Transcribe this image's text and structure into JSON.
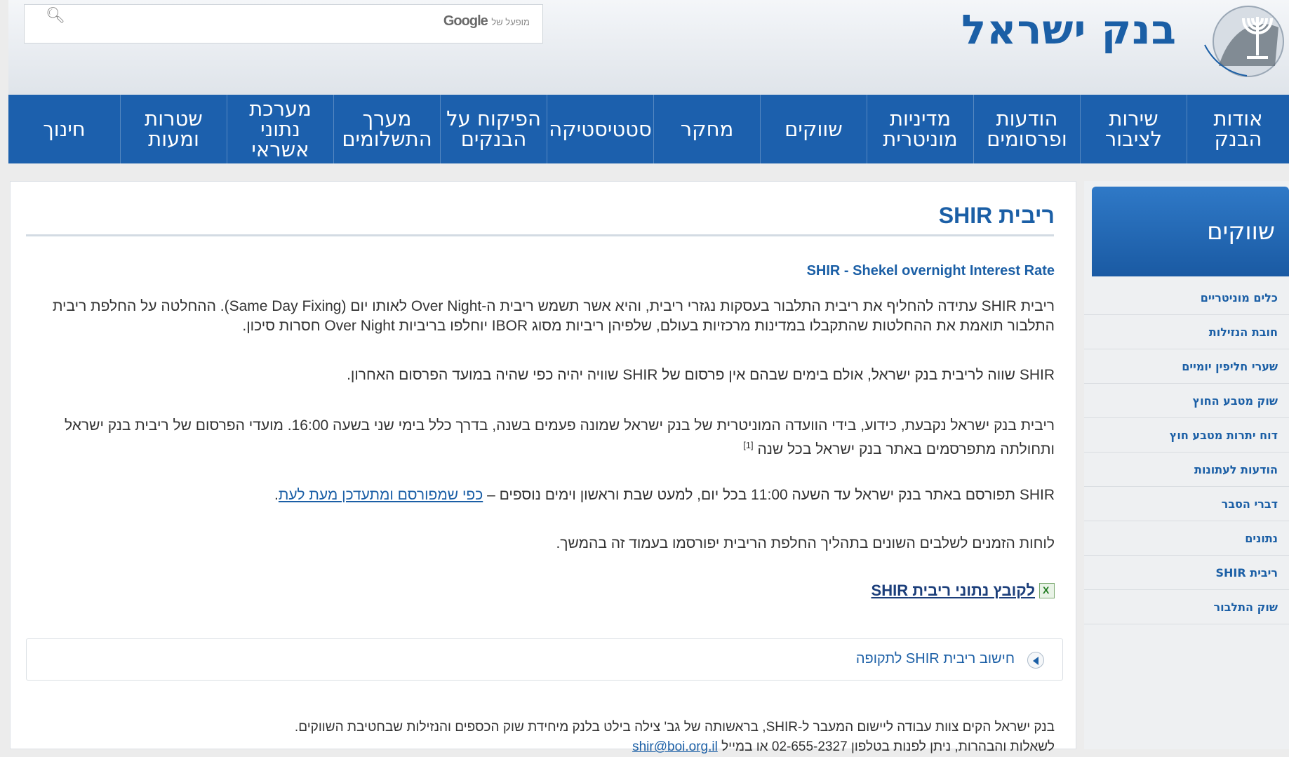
{
  "header": {
    "bank_name": "בנק ישראל",
    "search": {
      "brand": "Google",
      "brand_suffix": "מופעל של",
      "search_icon": "search-icon"
    }
  },
  "nav": {
    "items": [
      {
        "label": "אודות\nהבנק"
      },
      {
        "label": "שירות\nלציבור"
      },
      {
        "label": "הודעות\nופרסומים"
      },
      {
        "label": "מדיניות\nמוניטרית"
      },
      {
        "label": "שווקים"
      },
      {
        "label": "מחקר"
      },
      {
        "label": "סטטיסטיקה"
      },
      {
        "label": "הפיקוח על\nהבנקים"
      },
      {
        "label": "מערך\nהתשלומים"
      },
      {
        "label": "מערכת\nנתוני\nאשראי"
      },
      {
        "label": "שטרות\nומעות"
      },
      {
        "label": "חינוך"
      }
    ]
  },
  "sidebar": {
    "heading": "שווקים",
    "items": [
      {
        "label": "כלים מוניטריים"
      },
      {
        "label": "חובת הנזילות"
      },
      {
        "label": "שערי חליפין יומיים"
      },
      {
        "label": "שוק מטבע החוץ"
      },
      {
        "label": "דוח יתרות מטבע חוץ"
      },
      {
        "label": "הודעות לעתונות"
      },
      {
        "label": "דברי הסבר"
      },
      {
        "label": "נתונים"
      },
      {
        "label": "ריבית SHIR"
      },
      {
        "label": "שוק התלבור"
      }
    ]
  },
  "main": {
    "title": "ריבית SHIR",
    "subtitle": "SHIR - Shekel overnight Interest Rate",
    "p1": "ריבית  SHIR עתידה להחליף את ריבית התלבור בעסקות נגזרי ריבית, והיא אשר תשמש ריבית ה-Over Night לאותו יום  (Same Day Fixing). ההחלטה על החלפת ריבית התלבור תואמת את ההחלטות שהתקבלו במדינות מרכזיות בעולם, שלפיהן ריביות מסוג  IBOR יוחלפו בריביות  Over Night חסרות סיכון.",
    "p2": "SHIR שווה לריבית בנק ישראל, אולם בימים שבהם אין פרסום של SHIR שוויה יהיה כפי שהיה במועד הפרסום האחרון.",
    "p3": "ריבית בנק ישראל נקבעת, כידוע, בידי הוועדה המוניטרית של בנק ישראל שמונה פעמים בשנה, בדרך כלל בימי שני בשעה 16:00. מועדי הפרסום של ריבית בנק ישראל ותחולתה מתפרסמים באתר בנק ישראל בכל שנה ",
    "p3_footnote": "[1]",
    "p4_text": "SHIR תפורסם באתר בנק ישראל עד השעה 11:00 בכל יום, למעט שבת וראשון וימים נוספים – ",
    "p4_link": "כפי שמפורסם ומתעדכן מעת לעת",
    "p4_end": ".",
    "p5": "לוחות הזמנים לשלבים השונים בתהליך החלפת הריבית יפורסמו בעמוד זה בהמשך.",
    "file_link": "לקובץ נתוני ריבית SHIR",
    "accordion_label": "חישוב ריבית SHIR לתקופה",
    "p6": "בנק ישראל הקים צוות עבודה ליישום המעבר ל-SHIR, בראשותה של גב' צילה בילט בלנק מיחידת שוק הכספים והנזילות שבחטיבת השווקים.",
    "p7_text": "לשאלות והבהרות, ניתן לפנות בטלפון 02-655-2327 או במייל ",
    "p7_email": "shir@boi.org.il"
  },
  "colors": {
    "brand_blue": "#1b5fa6",
    "nav_blue": "#1c60ad"
  }
}
